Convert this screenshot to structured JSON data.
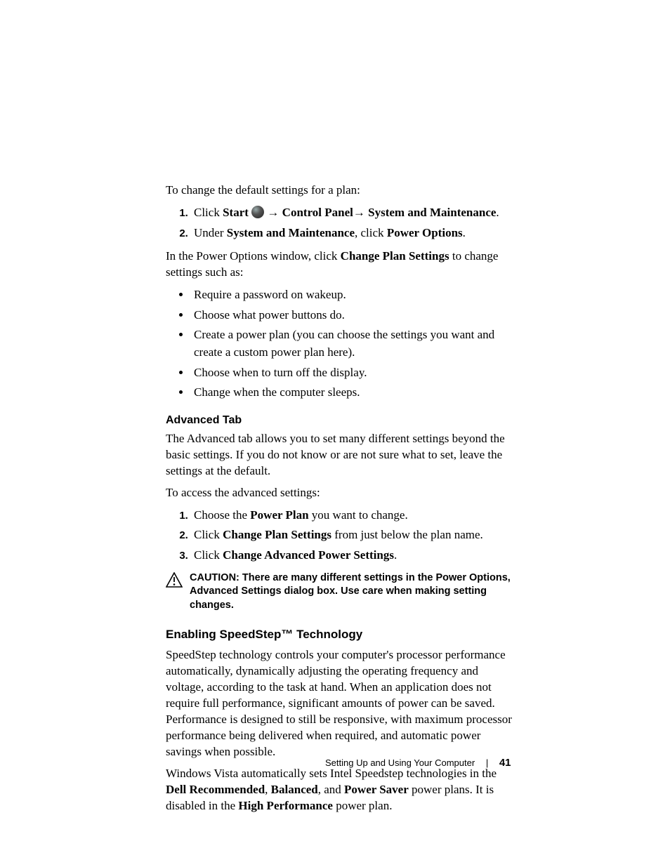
{
  "intro": "To change the default settings for a plan:",
  "steps1": {
    "s1_pre": "Click ",
    "s1_start": "Start",
    "s1_arrow1": " → ",
    "s1_cp": "Control Panel",
    "s1_arrow2": "→ ",
    "s1_sm": "System and Maintenance",
    "s1_end": ".",
    "s2_pre": "Under ",
    "s2_sm": "System and Maintenance",
    "s2_mid": ", click ",
    "s2_po": "Power Options",
    "s2_end": "."
  },
  "para2_pre": "In the Power Options window, click ",
  "para2_b": "Change Plan Settings",
  "para2_post": " to change settings such as:",
  "bullets": [
    "Require a password on wakeup.",
    "Choose what power buttons do.",
    "Create a power plan (you can choose the settings you want and create a custom power plan here).",
    "Choose when to turn off the display.",
    "Change when the computer sleeps."
  ],
  "adv_heading": "Advanced Tab",
  "adv_para": "The Advanced tab allows you to set many different settings beyond the basic settings. If you do not know or are not sure what to set, leave the settings at the default.",
  "adv_access": "To access the advanced settings:",
  "steps2": {
    "s1_pre": "Choose the ",
    "s1_b": "Power Plan",
    "s1_post": " you want to change.",
    "s2_pre": "Click ",
    "s2_b": "Change Plan Settings",
    "s2_post": " from just below the plan name.",
    "s3_pre": "Click ",
    "s3_b": "Change Advanced Power Settings",
    "s3_post": "."
  },
  "caution_label": "CAUTION: ",
  "caution_text": "There are many different settings in the Power Options, Advanced Settings dialog box. Use care when making setting changes.",
  "ss_heading": "Enabling SpeedStep™ Technology",
  "ss_para1": "SpeedStep technology controls your computer's processor performance automatically, dynamically adjusting the operating frequency and voltage, according to the task at hand. When an application does not require full performance, significant amounts of power can be saved. Performance is designed to still be responsive, with maximum processor performance being delivered when required, and automatic power savings when possible.",
  "ss2_pre": "Windows Vista automatically sets Intel Speedstep technologies in the ",
  "ss2_b1": "Dell Recommended",
  "ss2_mid1": ", ",
  "ss2_b2": "Balanced",
  "ss2_mid2": ", and ",
  "ss2_b3": "Power Saver",
  "ss2_mid3": " power plans. It is disabled in the ",
  "ss2_b4": "High Performance",
  "ss2_post": " power plan.",
  "footer_section": "Setting Up and Using Your Computer",
  "footer_page": "41"
}
